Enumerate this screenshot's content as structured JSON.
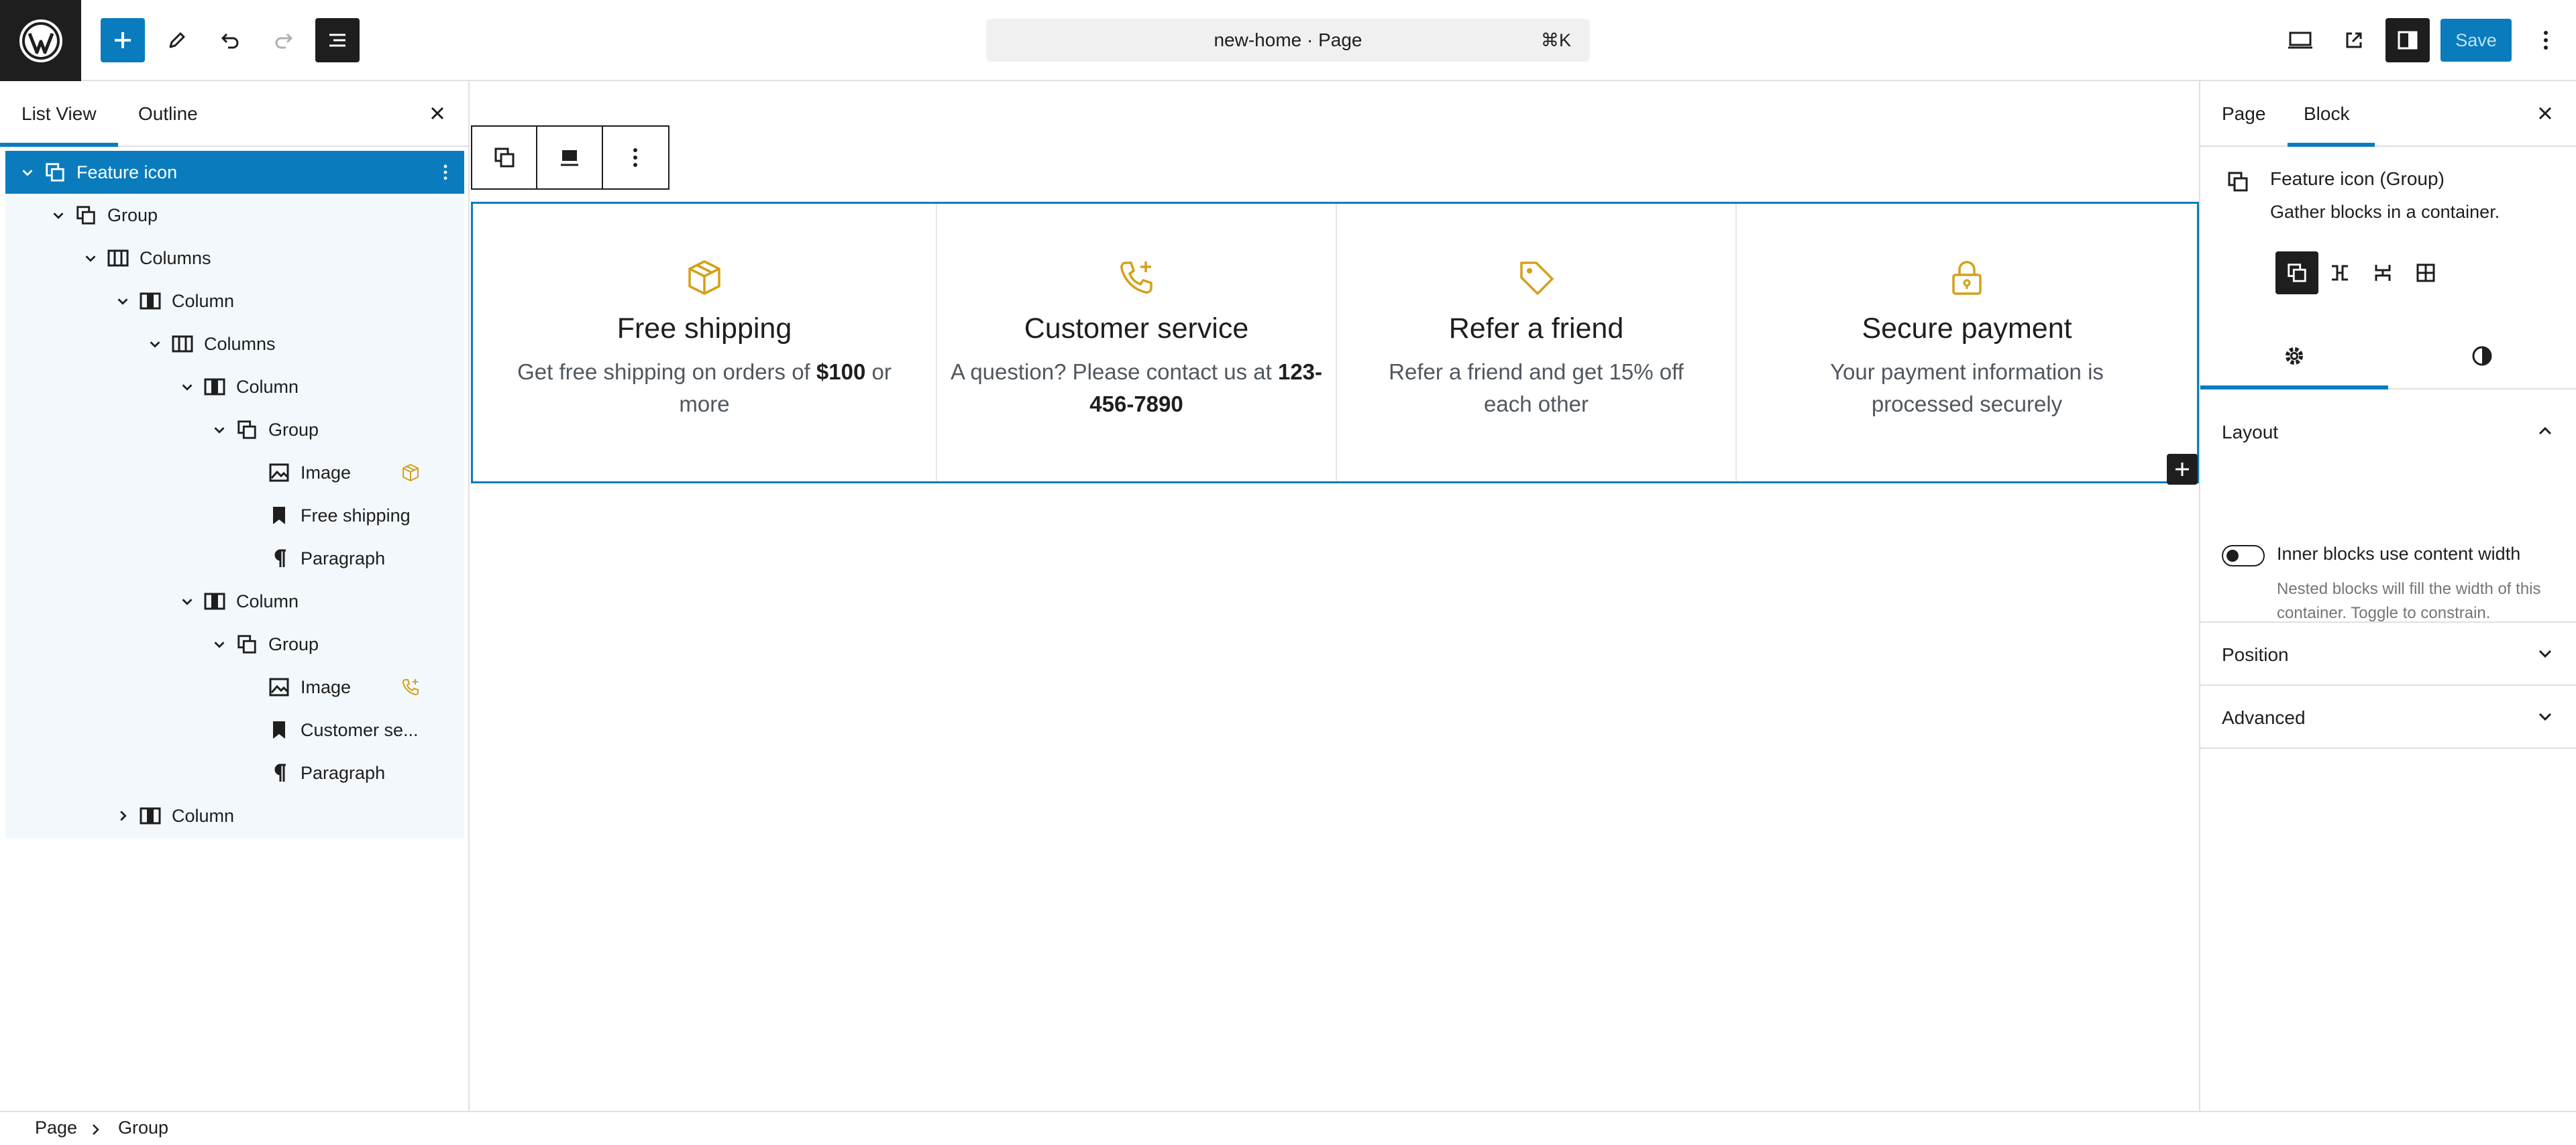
{
  "topbar": {
    "document_title": "new-home · Page",
    "shortcut": "⌘K",
    "save_label": "Save"
  },
  "list_view": {
    "tabs": [
      "List View",
      "Outline"
    ],
    "rows": [
      {
        "label": "Feature icon",
        "level": 0,
        "icon": "group-icon",
        "chevron": "down",
        "selected": true
      },
      {
        "label": "Group",
        "level": 1,
        "icon": "group-icon",
        "chevron": "down"
      },
      {
        "label": "Columns",
        "level": 2,
        "icon": "columns-icon",
        "chevron": "down"
      },
      {
        "label": "Column",
        "level": 3,
        "icon": "column-icon",
        "chevron": "down"
      },
      {
        "label": "Columns",
        "level": 4,
        "icon": "columns-icon",
        "chevron": "down"
      },
      {
        "label": "Column",
        "level": 5,
        "icon": "column-icon",
        "chevron": "down"
      },
      {
        "label": "Group",
        "level": 6,
        "icon": "group-icon",
        "chevron": "down"
      },
      {
        "label": "Image",
        "level": 7,
        "icon": "image-icon",
        "thumb": "box-icon"
      },
      {
        "label": "Free shipping",
        "level": 7,
        "icon": "heading-icon"
      },
      {
        "label": "Paragraph",
        "level": 7,
        "icon": "paragraph-icon"
      },
      {
        "label": "Column",
        "level": 5,
        "icon": "column-icon",
        "chevron": "down"
      },
      {
        "label": "Group",
        "level": 6,
        "icon": "group-icon",
        "chevron": "down"
      },
      {
        "label": "Image",
        "level": 7,
        "icon": "image-icon",
        "thumb": "phone-icon"
      },
      {
        "label": "Customer se...",
        "level": 7,
        "icon": "heading-icon"
      },
      {
        "label": "Paragraph",
        "level": 7,
        "icon": "paragraph-icon"
      },
      {
        "label": "Column",
        "level": 3,
        "icon": "column-icon",
        "chevron": "right"
      }
    ]
  },
  "features": [
    {
      "icon": "box-icon",
      "title": "Free shipping",
      "text_before": "Get free shipping on orders of ",
      "text_bold": "$100",
      "text_after": " or more"
    },
    {
      "icon": "phone-icon",
      "title": "Customer service",
      "text_before": "A question? Please contact us at ",
      "text_bold": "123-456-7890",
      "text_after": ""
    },
    {
      "icon": "tag-icon",
      "title": "Refer a friend",
      "text_before": "Refer a friend and get 15% off each other",
      "text_bold": "",
      "text_after": ""
    },
    {
      "icon": "lock-icon",
      "title": "Secure payment",
      "text_before": "Your payment information is processed securely",
      "text_bold": "",
      "text_after": ""
    }
  ],
  "sidebar": {
    "tabs": [
      "Page",
      "Block"
    ],
    "block_title": "Feature icon (Group)",
    "block_description": "Gather blocks in a container.",
    "sections": {
      "layout": {
        "title": "Layout",
        "toggle_label": "Inner blocks use content width",
        "toggle_help": "Nested blocks will fill the width of this container. Toggle to constrain."
      },
      "position": {
        "title": "Position"
      },
      "advanced": {
        "title": "Advanced"
      }
    }
  },
  "breadcrumb": [
    "Page",
    "Group"
  ],
  "colors": {
    "accent": "#0a7cbd",
    "icon_gold": "#d4a017",
    "dark": "#1e1e1e"
  }
}
